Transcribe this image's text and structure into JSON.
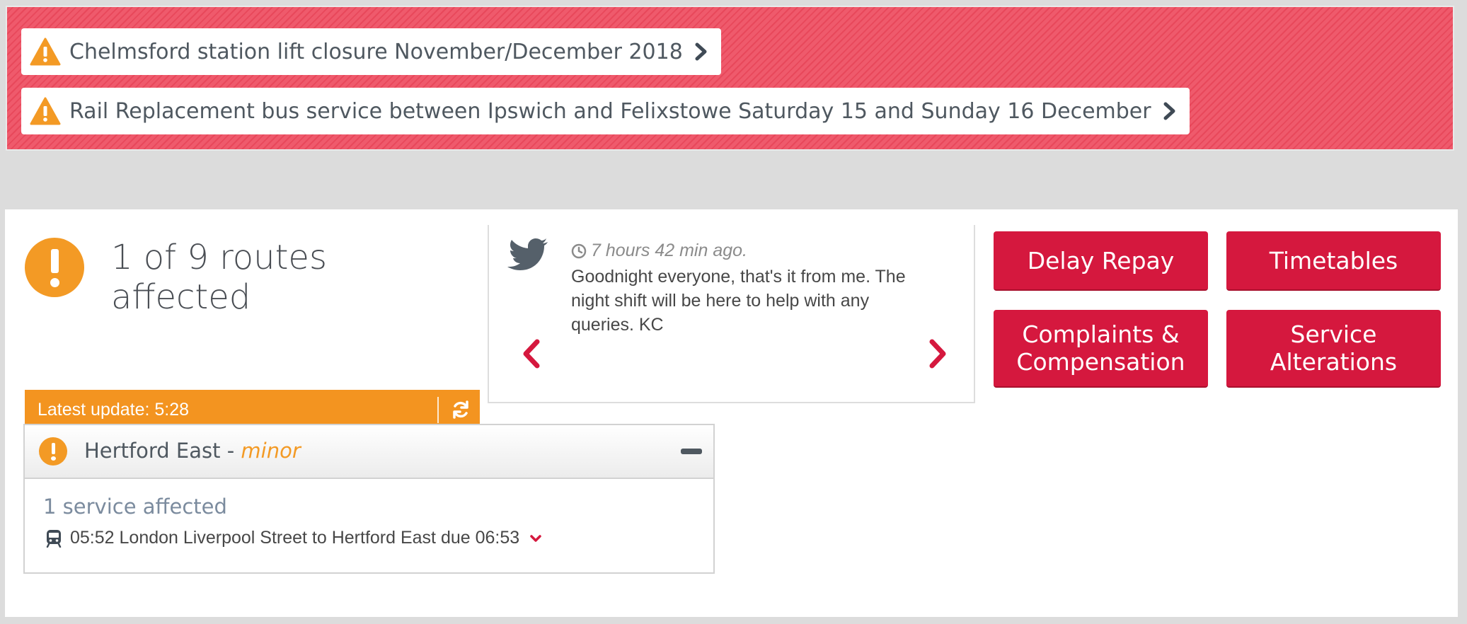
{
  "alerts": [
    {
      "text": "Chelmsford station lift closure November/December 2018",
      "icon": "warning-icon"
    },
    {
      "text": "Rail Replacement bus service between Ipswich and Felixstowe Saturday 15 and Sunday 16 December",
      "icon": "warning-icon"
    }
  ],
  "status": {
    "summary": "1 of 9 routes affected",
    "latest_update": "Latest update: 5:28"
  },
  "tweet": {
    "time": "7 hours 42 min ago.",
    "text": "Goodnight everyone, that's it from me. The night shift will be here to help with any queries. KC"
  },
  "buttons": {
    "delay_repay": "Delay Repay",
    "timetables": "Timetables",
    "complaints": "Complaints & Compensation",
    "service_alterations": "Service Alterations"
  },
  "route": {
    "name": "Hertford East - ",
    "severity": "minor",
    "services_count": "1 service affected",
    "service": "05:52 London Liverpool Street to Hertford East due 06:53"
  },
  "colors": {
    "alert_bg": "#ef5a6c",
    "warning_orange": "#f39a25",
    "button_red": "#d5183e",
    "text_gray": "#4f5860"
  }
}
